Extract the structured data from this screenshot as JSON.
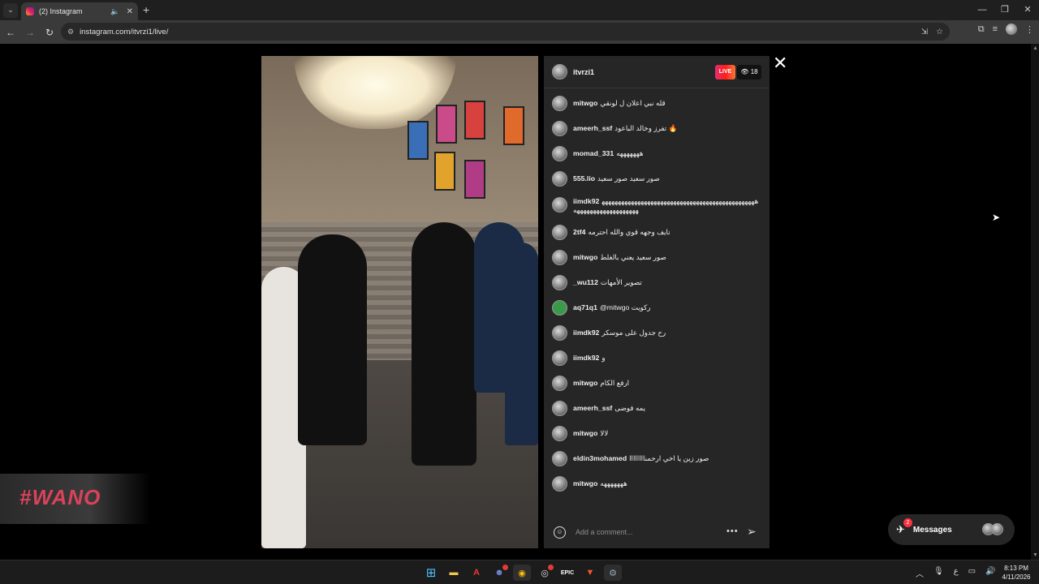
{
  "browser": {
    "tab_title": "(2) Instagram",
    "url": "instagram.com/itvrzi1/live/",
    "win_minimize": "—",
    "win_restore": "❐",
    "win_close": "✕"
  },
  "live": {
    "host_username": "itvrzi1",
    "live_label": "LIVE",
    "viewer_count": "18",
    "comments": [
      {
        "user": "mitwgo",
        "text": "قله نبي اعلان ل لونقي"
      },
      {
        "user": "ameerh_ssf",
        "text": "تفرز وخالد الباعود 🔥"
      },
      {
        "user": "momad_331",
        "text": "هههههههه"
      },
      {
        "user": "555.lio",
        "text": "صور سعيد صور سعيد"
      },
      {
        "user": "iimdk92",
        "text": "هههههههههههههههههههههههههههههههههههههههههههههههههههههههههههههههههههه"
      },
      {
        "user": "2tf4",
        "text": "نايف وجهه قوي والله احترمه"
      },
      {
        "user": "mitwgo",
        "text": "صور سعيد يعني بالغلط"
      },
      {
        "user": "_wu112",
        "text": "تصوير الأمهات"
      },
      {
        "user": "aq71q1",
        "text": "@mitwgo ركويت"
      },
      {
        "user": "iimdk92",
        "text": "رح جدول على موسكر"
      },
      {
        "user": "iimdk92",
        "text": "و"
      },
      {
        "user": "mitwgo",
        "text": "ارفع الكام"
      },
      {
        "user": "ameerh_ssf",
        "text": "يمه فوضى"
      },
      {
        "user": "mitwgo",
        "text": "لالا"
      },
      {
        "user": "eldin3mohamed",
        "text": "صور زين يا اخي ارحمناااااااا"
      },
      {
        "user": "mitwgo",
        "text": "هههههههه"
      }
    ],
    "comment_placeholder": "Add a comment..."
  },
  "overlay_logo_text": "#WANO",
  "messages": {
    "label": "Messages",
    "badge": "2"
  },
  "taskbar": {
    "time": "8:13 PM",
    "date": "4/11/2026",
    "lang": "ع"
  },
  "colors": {
    "live_gradient_start": "#e1306c",
    "panel_bg": "#262626",
    "badge_red": "#ff3040"
  }
}
